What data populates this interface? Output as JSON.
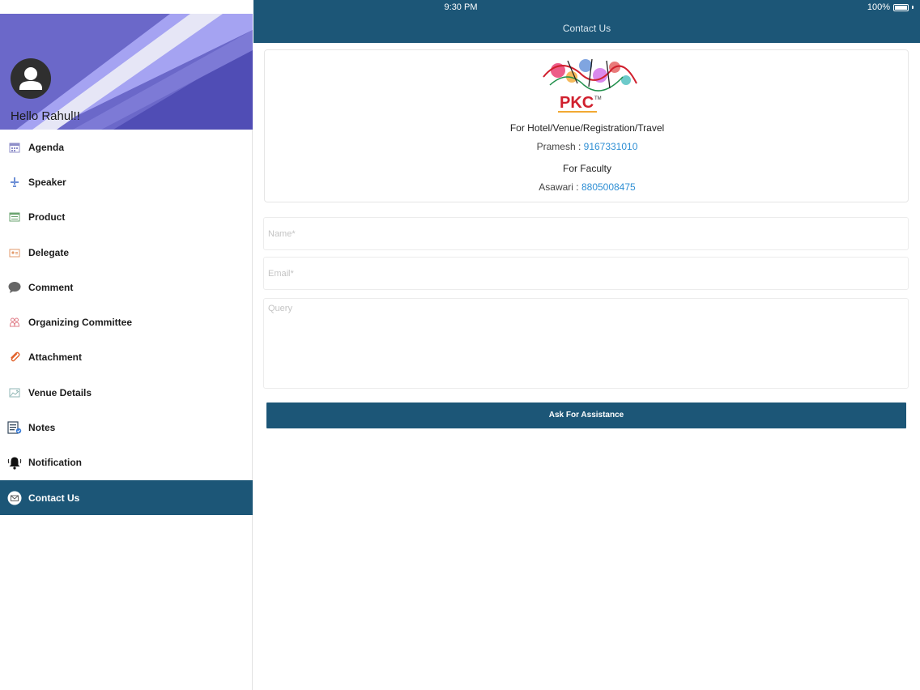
{
  "status_bar": {
    "time": "9:30 PM",
    "battery": "100%"
  },
  "navbar": {
    "title": "Contact Us"
  },
  "sidebar": {
    "greeting": "Hello Rahul!!",
    "header_colors": [
      "#6b68c9",
      "#a5a3f2",
      "#e6e6f6",
      "#504db5"
    ],
    "items": [
      {
        "label": "Agenda",
        "icon": "calendar-icon",
        "active": false
      },
      {
        "label": "Speaker",
        "icon": "speaker-icon",
        "active": false
      },
      {
        "label": "Product",
        "icon": "product-icon",
        "active": false
      },
      {
        "label": "Delegate",
        "icon": "delegate-icon",
        "active": false
      },
      {
        "label": "Comment",
        "icon": "comment-icon",
        "active": false
      },
      {
        "label": "Organizing Committee",
        "icon": "committee-icon",
        "active": false
      },
      {
        "label": "Attachment",
        "icon": "attachment-icon",
        "active": false
      },
      {
        "label": "Venue Details",
        "icon": "venue-icon",
        "active": false
      },
      {
        "label": "Notes",
        "icon": "notes-icon",
        "active": false
      },
      {
        "label": "Notification",
        "icon": "bell-icon",
        "active": false
      },
      {
        "label": "Contact Us",
        "icon": "mail-icon",
        "active": true
      }
    ]
  },
  "contact": {
    "logo_text": "PKC",
    "logo_tm": "TM",
    "section1_title": "For Hotel/Venue/Registration/Travel",
    "section1_name": "Pramesh : ",
    "section1_phone": "9167331010",
    "section2_title": "For Faculty",
    "section2_name": "Asawari : ",
    "section2_phone": "8805008475"
  },
  "form": {
    "name_placeholder": "Name*",
    "email_placeholder": "Email*",
    "query_placeholder": "Query",
    "submit_label": "Ask For Assistance"
  },
  "colors": {
    "primary": "#1c5677",
    "link": "#2f8fd4",
    "logo_red": "#d0202e"
  }
}
